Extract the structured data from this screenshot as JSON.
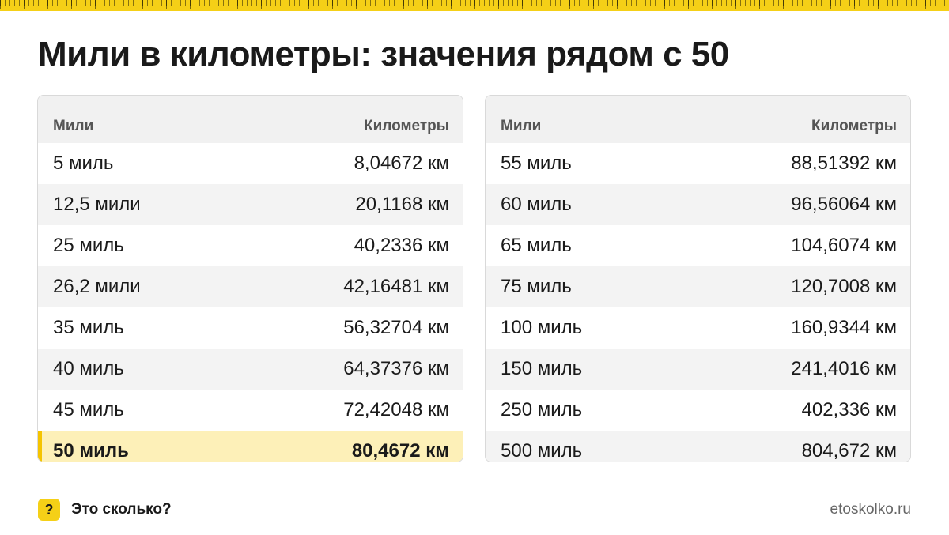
{
  "title": "Мили в километры: значения рядом с 50",
  "colors": {
    "accent": "#f5d017",
    "highlight_bg": "#fdf0b8",
    "header_bg": "#f1f1f1"
  },
  "tables": [
    {
      "header": {
        "miles": "Мили",
        "km": "Километры"
      },
      "rows": [
        {
          "miles": "5 миль",
          "km": "8,04672 км"
        },
        {
          "miles": "12,5 мили",
          "km": "20,1168 км"
        },
        {
          "miles": "25 миль",
          "km": "40,2336 км"
        },
        {
          "miles": "26,2 мили",
          "km": "42,16481 км"
        },
        {
          "miles": "35 миль",
          "km": "56,32704 км"
        },
        {
          "miles": "40 миль",
          "km": "64,37376 км"
        },
        {
          "miles": "45 миль",
          "km": "72,42048 км"
        },
        {
          "miles": "50 миль",
          "km": "80,4672 км",
          "highlighted": true
        }
      ]
    },
    {
      "header": {
        "miles": "Мили",
        "km": "Километры"
      },
      "rows": [
        {
          "miles": "55 миль",
          "km": "88,51392 км"
        },
        {
          "miles": "60 миль",
          "km": "96,56064 км"
        },
        {
          "miles": "65 миль",
          "km": "104,6074 км"
        },
        {
          "miles": "75 миль",
          "km": "120,7008 км"
        },
        {
          "miles": "100 миль",
          "km": "160,9344 км"
        },
        {
          "miles": "150 миль",
          "km": "241,4016 км"
        },
        {
          "miles": "250 миль",
          "km": "402,336 км"
        },
        {
          "miles": "500 миль",
          "km": "804,672 км"
        }
      ]
    }
  ],
  "footer": {
    "badge_icon": "question-icon",
    "badge_glyph": "?",
    "brand": "Это сколько?",
    "site": "etoskolko.ru"
  }
}
